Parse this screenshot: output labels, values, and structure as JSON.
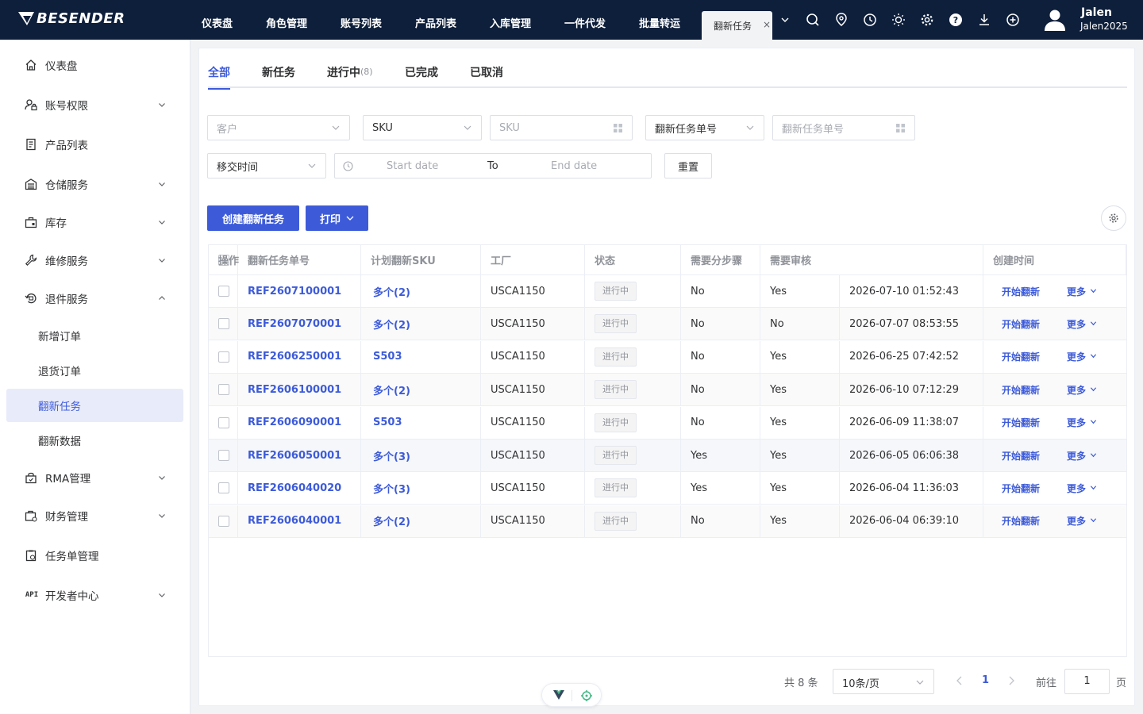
{
  "brand": "BESENDER",
  "nav": [
    "仪表盘",
    "角色管理",
    "账号列表",
    "产品列表",
    "入库管理",
    "一件代发",
    "批量转运"
  ],
  "active_tab": "翻新任务",
  "active_tab_close": "×",
  "user": {
    "name": "Jalen",
    "id": "Jalen2025"
  },
  "sidebar": {
    "items": [
      {
        "label": "仪表盘",
        "icon": "home-icon",
        "expandable": false
      },
      {
        "label": "账号权限",
        "icon": "user-lock-icon",
        "expandable": true
      },
      {
        "label": "产品列表",
        "icon": "document-icon",
        "expandable": false
      },
      {
        "label": "仓储服务",
        "icon": "warehouse-icon",
        "expandable": true
      },
      {
        "label": "库存",
        "icon": "inventory-icon",
        "expandable": true
      },
      {
        "label": "维修服务",
        "icon": "wrench-icon",
        "expandable": true
      },
      {
        "label": "退件服务",
        "icon": "return-icon",
        "expandable": true,
        "expanded": true
      }
    ],
    "sub_items": [
      "新增订单",
      "退货订单",
      "翻新任务",
      "翻新数据"
    ],
    "active_sub": "翻新任务",
    "items_after": [
      {
        "label": "RMA管理",
        "icon": "rma-icon",
        "expandable": true
      },
      {
        "label": "财务管理",
        "icon": "finance-icon",
        "expandable": true
      },
      {
        "label": "任务单管理",
        "icon": "task-icon",
        "expandable": false
      },
      {
        "label": "开发者中心",
        "icon": "api-icon",
        "expandable": true
      }
    ],
    "api_icon_text": "API"
  },
  "tabs": [
    {
      "label": "全部",
      "count": ""
    },
    {
      "label": "新任务",
      "count": ""
    },
    {
      "label": "进行中",
      "count": "(8)"
    },
    {
      "label": "已完成",
      "count": ""
    },
    {
      "label": "已取消",
      "count": ""
    }
  ],
  "filters": {
    "customer_placeholder": "客户",
    "sku_select": "SKU",
    "sku_input_placeholder": "SKU",
    "task_no_select": "翻新任务单号",
    "task_no_placeholder": "翻新任务单号",
    "time_select": "移交时间",
    "start_date": "Start date",
    "to": "To",
    "end_date": "End date",
    "reset": "重置"
  },
  "actions": {
    "create": "创建翻新任务",
    "print": "打印"
  },
  "table": {
    "headers": [
      "翻新任务单号",
      "计划翻新SKU",
      "工厂",
      "状态",
      "需要分步骤",
      "需要审核",
      "创建时间",
      "操作"
    ],
    "rows": [
      {
        "no": "REF2607100001",
        "sku": "多个(2)",
        "factory": "USCA1150",
        "status": "进行中",
        "steps": "No",
        "review": "Yes",
        "created": "2026-07-10 01:52:43"
      },
      {
        "no": "REF2607070001",
        "sku": "多个(2)",
        "factory": "USCA1150",
        "status": "进行中",
        "steps": "No",
        "review": "No",
        "created": "2026-07-07 08:53:55"
      },
      {
        "no": "REF2606250001",
        "sku": "S503",
        "factory": "USCA1150",
        "status": "进行中",
        "steps": "No",
        "review": "Yes",
        "created": "2026-06-25 07:42:52"
      },
      {
        "no": "REF2606100001",
        "sku": "多个(2)",
        "factory": "USCA1150",
        "status": "进行中",
        "steps": "No",
        "review": "Yes",
        "created": "2026-06-10 07:12:29"
      },
      {
        "no": "REF2606090001",
        "sku": "S503",
        "factory": "USCA1150",
        "status": "进行中",
        "steps": "No",
        "review": "Yes",
        "created": "2026-06-09 11:38:07"
      },
      {
        "no": "REF2606050001",
        "sku": "多个(3)",
        "factory": "USCA1150",
        "status": "进行中",
        "steps": "Yes",
        "review": "Yes",
        "created": "2026-06-05 06:06:38"
      },
      {
        "no": "REF2606040020",
        "sku": "多个(3)",
        "factory": "USCA1150",
        "status": "进行中",
        "steps": "Yes",
        "review": "Yes",
        "created": "2026-06-04 11:36:03"
      },
      {
        "no": "REF2606040001",
        "sku": "多个(2)",
        "factory": "USCA1150",
        "status": "进行中",
        "steps": "No",
        "review": "Yes",
        "created": "2026-06-04 06:39:10"
      }
    ],
    "op_start": "开始翻新",
    "op_more": "更多"
  },
  "pagination": {
    "total": "共 8 条",
    "page_size": "10条/页",
    "current": "1",
    "goto_label": "前往",
    "goto_value": "1",
    "page_suffix": "页"
  },
  "colors": {
    "primary": "#3d5bd9",
    "topbar": "#0e1f3b",
    "active_bg": "#e8ebf9"
  }
}
